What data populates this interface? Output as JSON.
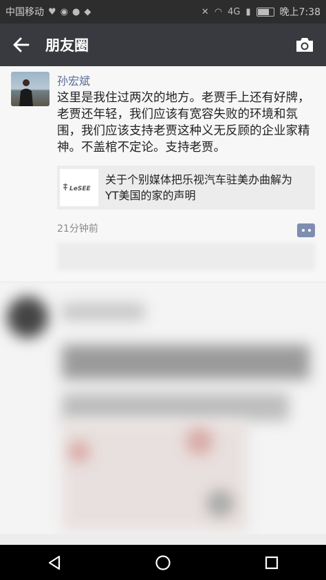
{
  "status_bar": {
    "carrier": "中国移动",
    "time": "晚上7:38",
    "network": "4G"
  },
  "header": {
    "title": "朋友圈"
  },
  "post": {
    "author": "孙宏斌",
    "text": "这里是我住过两次的地方。老贾手上还有好牌，老贾还年轻，我们应该有宽容失败的环境和氛围，我们应该支持老贾这种义无反顾的企业家精神。不盖棺不定论。支持老贾。",
    "link": {
      "logo_text": "LeSEE",
      "title": "关于个别媒体把乐视汽车驻美办曲解为YT美国的家的声明"
    },
    "time_ago": "21分钟前"
  },
  "icons": {
    "back": "back-arrow-icon",
    "camera": "camera-icon",
    "more": "more-dots-icon",
    "nav_back": "triangle-back-icon",
    "nav_home": "circle-home-icon",
    "nav_recent": "square-recent-icon"
  },
  "colors": {
    "nav_bg": "#393a3f",
    "name_blue": "#576b95",
    "status_bg": "#2d2d2d"
  }
}
